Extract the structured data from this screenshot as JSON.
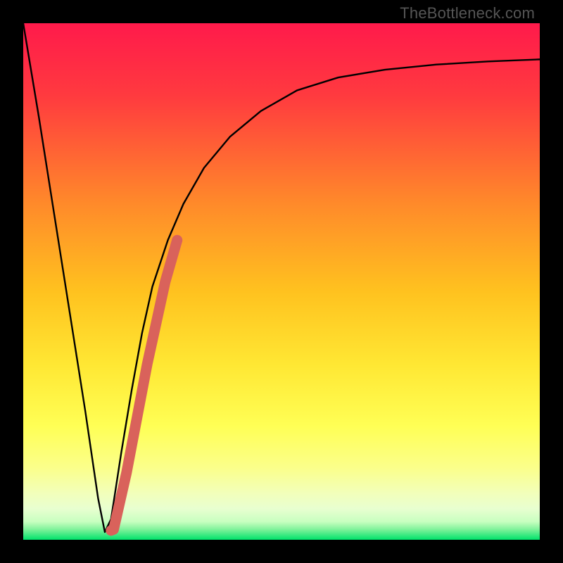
{
  "watermark": "TheBottleneck.com",
  "colors": {
    "frame": "#000000",
    "gradient_top": "#ff1a4b",
    "gradient_mid_upper": "#ff7a2a",
    "gradient_mid": "#ffd21f",
    "gradient_mid_lower": "#ffff55",
    "gradient_pale": "#f6ffb0",
    "gradient_green": "#00e26b",
    "curve": "#000000",
    "marker": "#d9625b"
  },
  "chart_data": {
    "type": "line",
    "title": "",
    "xlabel": "",
    "ylabel": "",
    "xlim": [
      0,
      100
    ],
    "ylim": [
      0,
      100
    ],
    "series": [
      {
        "name": "bottleneck-curve",
        "x": [
          0,
          3,
          6,
          9,
          12,
          14.5,
          15.8,
          17,
          19,
          21,
          23,
          25,
          28,
          31,
          35,
          40,
          46,
          53,
          61,
          70,
          80,
          90,
          100
        ],
        "y": [
          100,
          82,
          63,
          44,
          25,
          8,
          1.5,
          4,
          17,
          29,
          40,
          49,
          58,
          65,
          72,
          78,
          83,
          87,
          89.5,
          91,
          92,
          92.6,
          93
        ]
      }
    ],
    "marker_segment": {
      "name": "highlight-range",
      "x": [
        17.0,
        17.5,
        20.0,
        24.0,
        27.5,
        29.8
      ],
      "y": [
        1.8,
        2.0,
        13,
        34,
        50,
        58
      ]
    },
    "gradient_bands_pct_from_top": [
      {
        "stop": 0,
        "color": "#ff1a4b"
      },
      {
        "stop": 35,
        "color": "#ff7a2a"
      },
      {
        "stop": 58,
        "color": "#ffd21f"
      },
      {
        "stop": 77,
        "color": "#ffff55"
      },
      {
        "stop": 90,
        "color": "#f6ffb0"
      },
      {
        "stop": 96.5,
        "color": "#d9ffb8"
      },
      {
        "stop": 100,
        "color": "#00e26b"
      }
    ]
  }
}
